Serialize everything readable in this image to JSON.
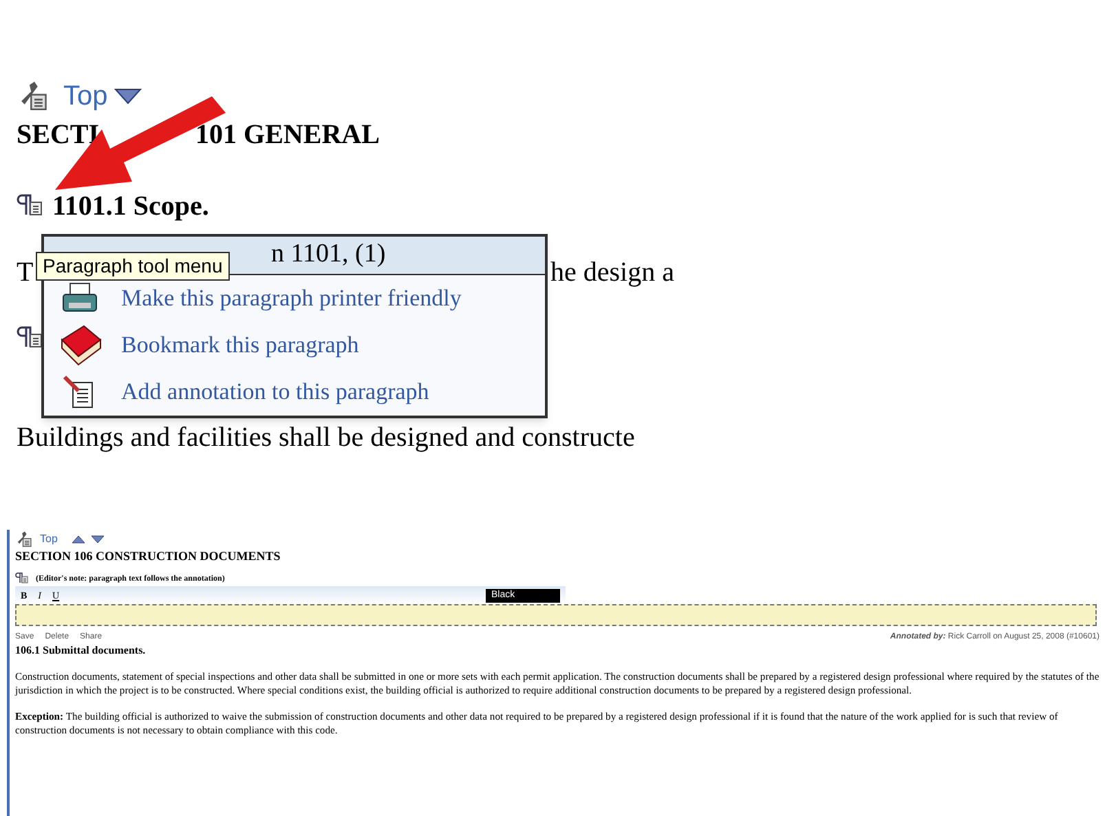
{
  "zoomed_view": {
    "nav": {
      "top_link": "Top"
    },
    "heading_parts": [
      "SECTI",
      "101 GENERAL"
    ],
    "subheading": "1101.1 Scope.",
    "behind_texts": [
      "T",
      "he design a"
    ],
    "last_line": "Buildings and facilities shall be designed and constructe",
    "menu": {
      "header": "n 1101, (1)",
      "items": [
        {
          "kind": "printer",
          "label": "Make this paragraph printer friendly"
        },
        {
          "kind": "bookmark",
          "label": "Bookmark this paragraph"
        },
        {
          "kind": "annotation",
          "label": "Add annotation to this paragraph"
        }
      ]
    },
    "tooltip": "Paragraph tool menu"
  },
  "page_view": {
    "nav": {
      "top_link": "Top"
    },
    "heading": "SECTION 106 CONSTRUCTION DOCUMENTS",
    "editor_note": "(Editor's note: paragraph text follows the annotation)",
    "toolbar": {
      "format_buttons": [
        "B",
        "I",
        "U"
      ],
      "color_select": "Black"
    },
    "actions": [
      "Save",
      "Delete",
      "Share"
    ],
    "annotated_by": {
      "label": "Annotated by:",
      "text": "Rick Carroll on August 25, 2008 (#10601)"
    },
    "subheading": "106.1 Submittal documents.",
    "paragraphs": [
      {
        "kind": "plain",
        "text": "Construction documents, statement of special inspections and other data shall be submitted in one or more sets with each permit application. The construction documents shall be prepared by a registered design professional where required by the statutes of the jurisdiction in which the project is to be constructed. Where special conditions exist, the building official is authorized to require additional construction documents to be prepared by a registered design professional."
      },
      {
        "kind": "exception",
        "lead": "Exception:",
        "text": "The building official is authorized to waive the submission of construction documents and other data not required to be prepared by a registered design professional if it is found that the nature of the work applied for is such that review of construction documents is not necessary to obtain compliance with this code."
      }
    ]
  }
}
